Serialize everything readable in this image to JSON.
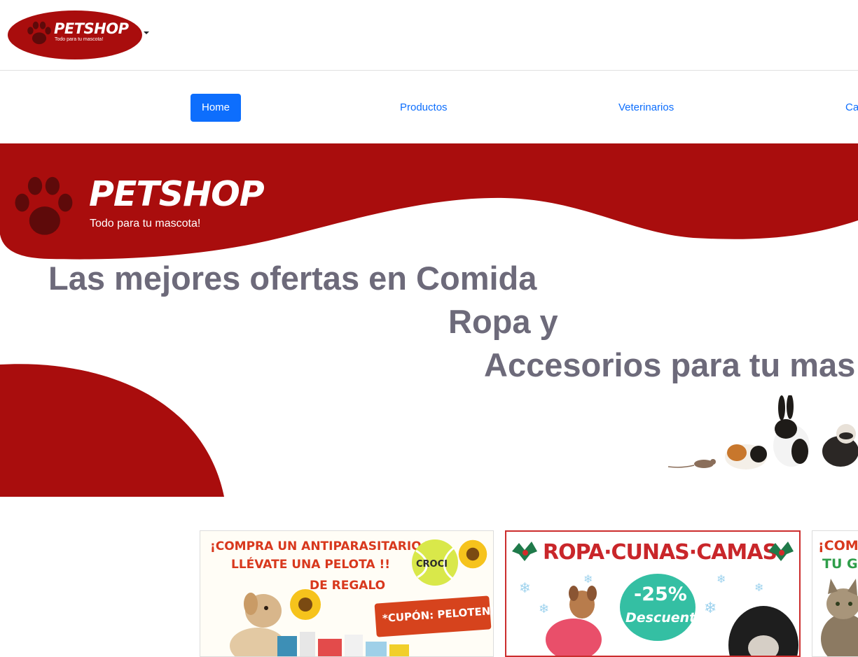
{
  "logo": {
    "brand": "PETSHOP",
    "tagline": "Todo para tu mascota!",
    "icon": "paw-icon",
    "color": "#a90d0d"
  },
  "nav": {
    "items": [
      {
        "label": "Home",
        "active": true
      },
      {
        "label": "Productos",
        "active": false
      },
      {
        "label": "Veterinarios",
        "active": false
      },
      {
        "label": "Ca",
        "active": false
      }
    ],
    "accent": "#0d6efd"
  },
  "hero": {
    "brand": "PETSHOP",
    "tagline": "Todo para tu mascota!",
    "icon": "paw-icon",
    "headline": {
      "line1": "Las mejores ofertas en Comida",
      "line2": "Ropa y",
      "line3": "Accesorios para tu mas"
    },
    "image": "pets-lineup-image",
    "wave_color": "#a90d0d",
    "text_color": "#6d6a7a"
  },
  "promos": [
    {
      "line1": "¡COMPRA UN ANTIPARASITARIO Y",
      "line2": "LLÉVATE UNA PELOTA !!",
      "line3": "DE REGALO",
      "brand": "CROCI",
      "coupon": "*CUPÓN: PELOTENIS*"
    },
    {
      "title_parts": [
        "ROPA",
        "CUNAS",
        "CAMAS"
      ],
      "badge_pct": "-25%",
      "badge_text": "Descuento"
    },
    {
      "line1": "¡COMPR",
      "line2": "TU GAT"
    }
  ]
}
